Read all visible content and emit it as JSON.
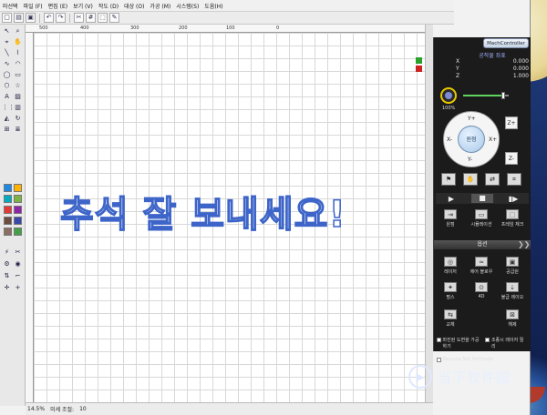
{
  "desktop": {
    "watermark_text": "当下软件园",
    "watermark_icon": "play-circle-icon"
  },
  "app": {
    "menu": [
      "마선택",
      "파일 (F)",
      "편집 (E)",
      "보기 (V)",
      "작도 (D)",
      "대상 (O)",
      "가공 (M)",
      "시스템(S)",
      "도움(H)"
    ],
    "toolbar": {
      "icons": [
        "new-icon",
        "open-icon",
        "save-icon",
        "undo-icon",
        "redo-icon",
        "cut-icon",
        "grid-icon",
        "select-icon",
        "pen-icon",
        "zoom-icon"
      ],
      "undo_label": "↶",
      "redo_label": "↷"
    },
    "ruler": {
      "h_labels": [
        "500",
        "400",
        "300",
        "200",
        "100",
        "0"
      ]
    },
    "canvas": {
      "main_text": "추석 잘 보내세요!"
    },
    "statusbar": {
      "zoom": "14.5%",
      "mode_label": "미세 조절:",
      "mode_value": "10"
    },
    "left_swatches": [
      "#1e88e5",
      "#ffb300",
      "#00acc1",
      "#7cb342",
      "#e53935",
      "#8e24aa",
      "#6d4c41",
      "#3949ab",
      "#8d6e63",
      "#43a047"
    ]
  },
  "controller": {
    "title": "MachController",
    "coord_title": "공작물 좌표",
    "coords": [
      {
        "axis": "X",
        "value": "0.000"
      },
      {
        "axis": "Y",
        "value": "0.000"
      },
      {
        "axis": "Z",
        "value": "1.000"
      }
    ],
    "speed_label": "100%",
    "speed_fraction": 0.85,
    "jog": {
      "up": "Y+",
      "down": "Y-",
      "left": "X-",
      "right": "X+",
      "center": "원점"
    },
    "z_up": "Z+",
    "z_down": "Z-",
    "functions_row1": [
      "원점",
      "시뮬레이션",
      "프레임 체크"
    ],
    "tab_label": "옵션",
    "functions_row2": [
      "레이저",
      "에어 블로우",
      "공급원"
    ],
    "functions_row3": [
      "펄스",
      "4D",
      "불급 레이오"
    ],
    "functions_row4": [
      "교체",
      "해제"
    ],
    "check1": "마진된 도면을 가공하기",
    "check2": "조종시 레이저 릴리",
    "check3": "Resume Not Perforate"
  }
}
